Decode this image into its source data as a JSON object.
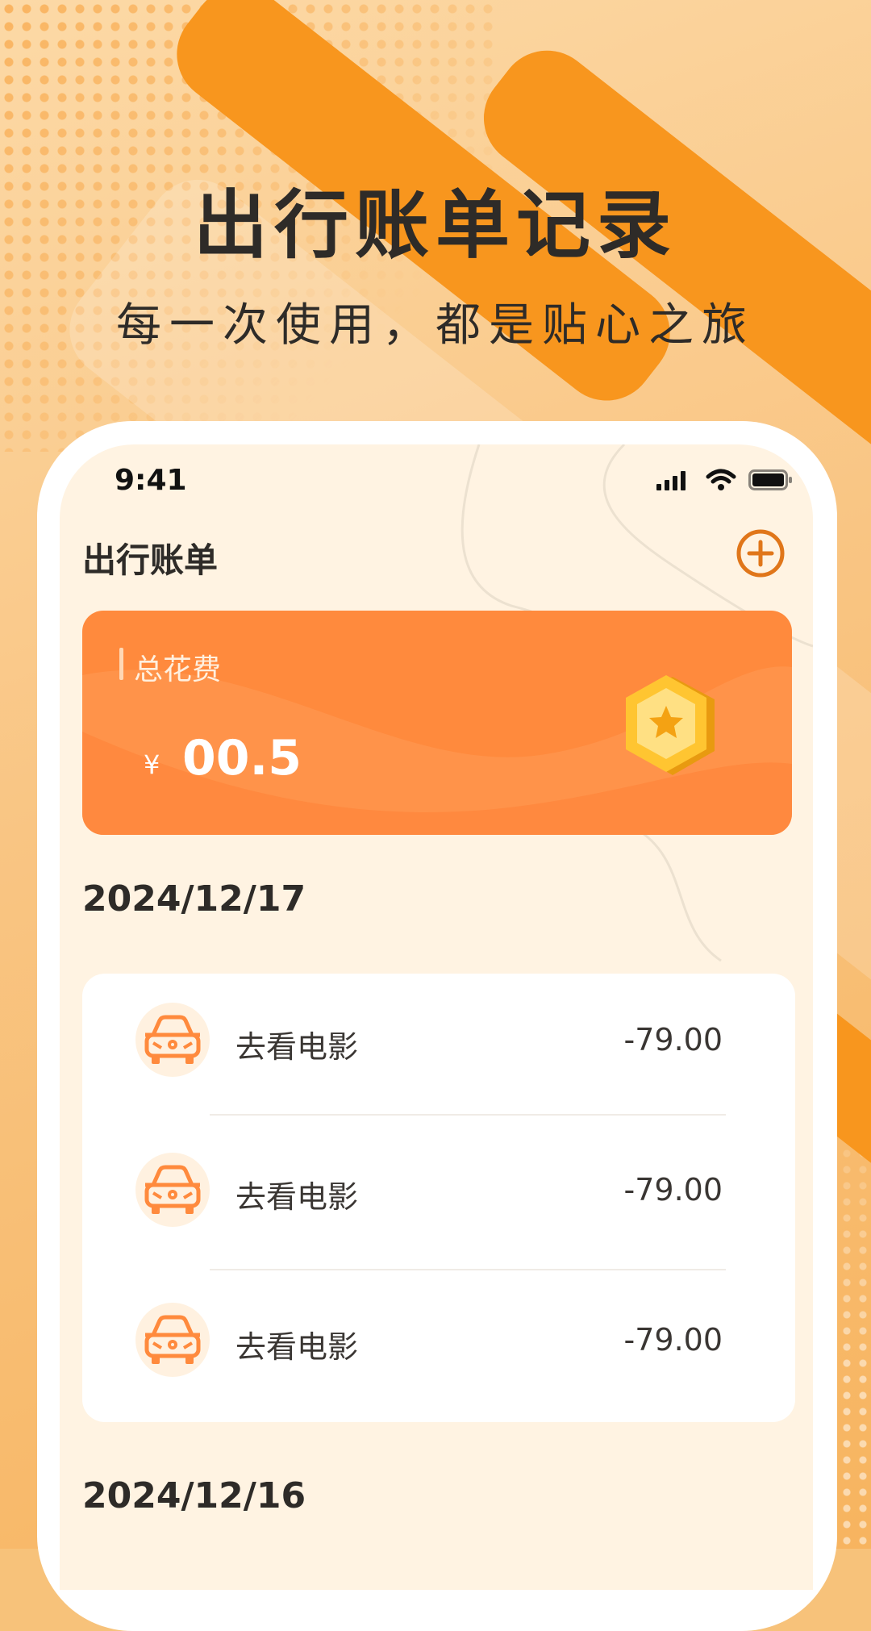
{
  "promo": {
    "headline": "出行账单记录",
    "subline": "每一次使用，都是贴心之旅"
  },
  "status_bar": {
    "time": "9:41",
    "icons": [
      "signal-icon",
      "wifi-icon",
      "battery-icon"
    ]
  },
  "header": {
    "title": "出行账单",
    "add_icon": "plus-circle-icon"
  },
  "summary": {
    "label": "总花费",
    "currency": "¥",
    "value": "00.5",
    "badge_icon": "star-medal-icon"
  },
  "groups": [
    {
      "date": "2024/12/17",
      "items": [
        {
          "icon": "car-icon",
          "label": "去看电影",
          "amount": "-79.00"
        },
        {
          "icon": "car-icon",
          "label": "去看电影",
          "amount": "-79.00"
        },
        {
          "icon": "car-icon",
          "label": "去看电影",
          "amount": "-79.00"
        }
      ]
    },
    {
      "date": "2024/12/16",
      "items": []
    }
  ],
  "colors": {
    "accent": "#ff8a3d",
    "accent_dark": "#e0761a",
    "background": "#fff3e2",
    "text": "#2e2b28"
  }
}
